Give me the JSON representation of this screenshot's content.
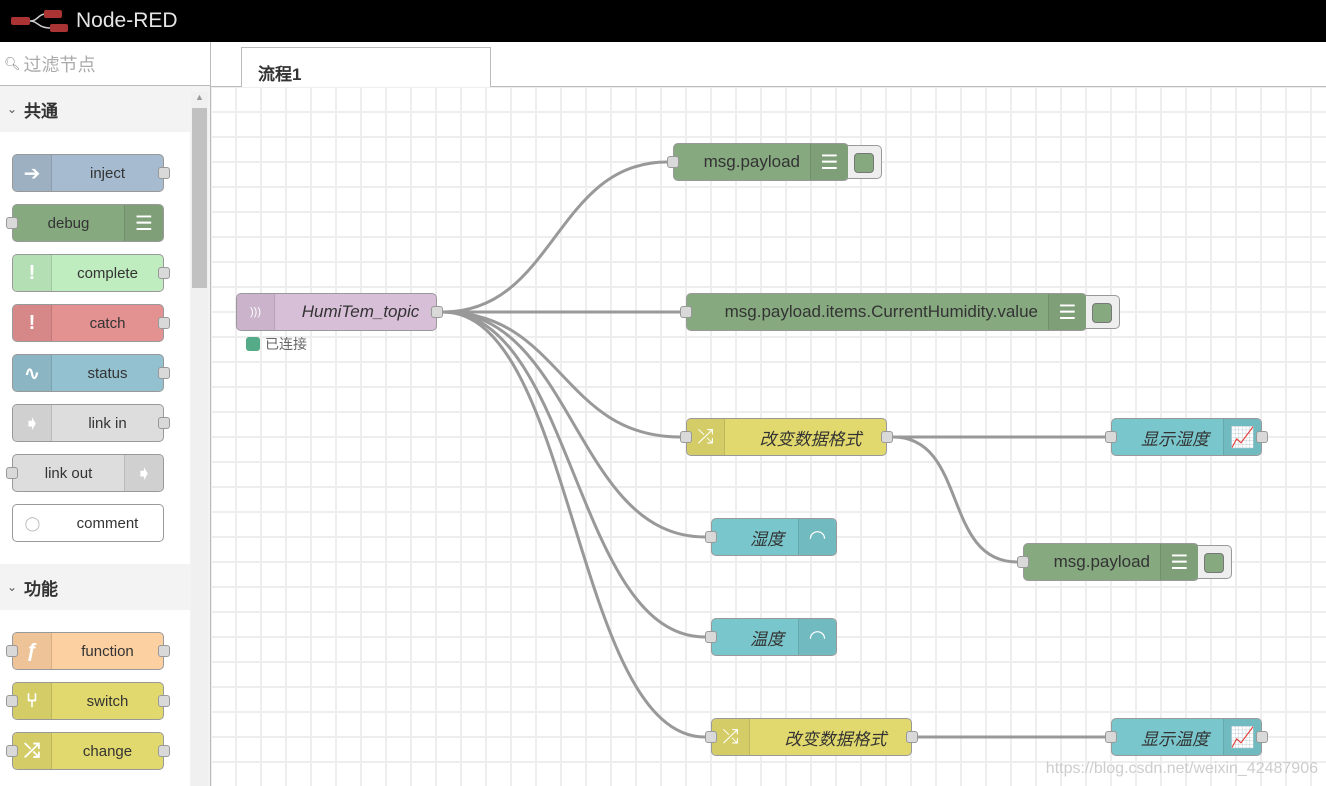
{
  "header": {
    "title": "Node-RED"
  },
  "sidebar": {
    "filter_placeholder": "过滤节点",
    "categories": [
      {
        "label": "共通",
        "nodes": [
          {
            "label": "inject",
            "color": "#a6bbcf",
            "icon": "arrow-right-icon",
            "side": "left",
            "in": false,
            "out": true
          },
          {
            "label": "debug",
            "color": "#87a980",
            "icon": "list-icon",
            "side": "right",
            "in": true,
            "out": false
          },
          {
            "label": "complete",
            "color": "#c0edc0",
            "icon": "exclamation-icon",
            "side": "left",
            "in": false,
            "out": true
          },
          {
            "label": "catch",
            "color": "#e49191",
            "icon": "exclamation-icon",
            "side": "left",
            "in": false,
            "out": true
          },
          {
            "label": "status",
            "color": "#94c1d0",
            "icon": "pulse-icon",
            "side": "left",
            "in": false,
            "out": true
          },
          {
            "label": "link in",
            "color": "#dddddd",
            "icon": "link-arrow-icon",
            "side": "left",
            "in": false,
            "out": true
          },
          {
            "label": "link out",
            "color": "#dddddd",
            "icon": "link-arrow-icon",
            "side": "right",
            "in": true,
            "out": false
          },
          {
            "label": "comment",
            "color": "#ffffff",
            "icon": "speech-bubble-icon",
            "side": "left",
            "in": false,
            "out": false
          }
        ]
      },
      {
        "label": "功能",
        "nodes": [
          {
            "label": "function",
            "color": "#fdd0a2",
            "icon": "function-icon",
            "side": "left",
            "in": true,
            "out": true
          },
          {
            "label": "switch",
            "color": "#e2d96e",
            "icon": "switch-icon",
            "side": "left",
            "in": true,
            "out": true
          },
          {
            "label": "change",
            "color": "#e2d96e",
            "icon": "shuffle-icon",
            "side": "left",
            "in": true,
            "out": true
          }
        ]
      }
    ]
  },
  "tabs": [
    {
      "label": "流程1"
    }
  ],
  "flow": {
    "nodes": [
      {
        "id": "dbg1",
        "label": "msg.payload",
        "type": "debug",
        "color": "#87a980",
        "icon": "list-icon",
        "italic": false
      },
      {
        "id": "mqtt",
        "label": "HumiTem_topic",
        "type": "mqtt in",
        "color": "#d8bfd8",
        "icon": "wireless-icon",
        "italic": true,
        "status": "已连接",
        "status_color": "#55aa88"
      },
      {
        "id": "dbg2",
        "label": "msg.payload.items.CurrentHumidity.value",
        "type": "debug",
        "color": "#87a980",
        "icon": "list-icon",
        "italic": false
      },
      {
        "id": "chg1",
        "label": "改变数据格式",
        "type": "change",
        "color": "#e2d96e",
        "icon": "shuffle-icon",
        "italic": true
      },
      {
        "id": "chart1",
        "label": "显示湿度",
        "type": "chart",
        "color": "#79c7cc",
        "icon": "chart-icon",
        "italic": true
      },
      {
        "id": "gauge1",
        "label": "湿度",
        "type": "gauge",
        "color": "#79c7cc",
        "icon": "gauge-icon",
        "italic": true
      },
      {
        "id": "dbg3",
        "label": "msg.payload",
        "type": "debug",
        "color": "#87a980",
        "icon": "list-icon",
        "italic": false
      },
      {
        "id": "gauge2",
        "label": "温度",
        "type": "gauge",
        "color": "#79c7cc",
        "icon": "gauge-icon",
        "italic": true
      },
      {
        "id": "chg2",
        "label": "改变数据格式",
        "type": "change",
        "color": "#e2d96e",
        "icon": "shuffle-icon",
        "italic": true
      },
      {
        "id": "chart2",
        "label": "显示温度",
        "type": "chart",
        "color": "#79c7cc",
        "icon": "chart-icon",
        "italic": true
      }
    ],
    "wires": [
      [
        "mqtt",
        "dbg1"
      ],
      [
        "mqtt",
        "dbg2"
      ],
      [
        "mqtt",
        "chg1"
      ],
      [
        "mqtt",
        "gauge1"
      ],
      [
        "mqtt",
        "gauge2"
      ],
      [
        "mqtt",
        "chg2"
      ],
      [
        "chg1",
        "chart1"
      ],
      [
        "chg1",
        "dbg3"
      ],
      [
        "chg2",
        "chart2"
      ]
    ]
  },
  "watermark": "https://blog.csdn.net/weixin_42487906"
}
